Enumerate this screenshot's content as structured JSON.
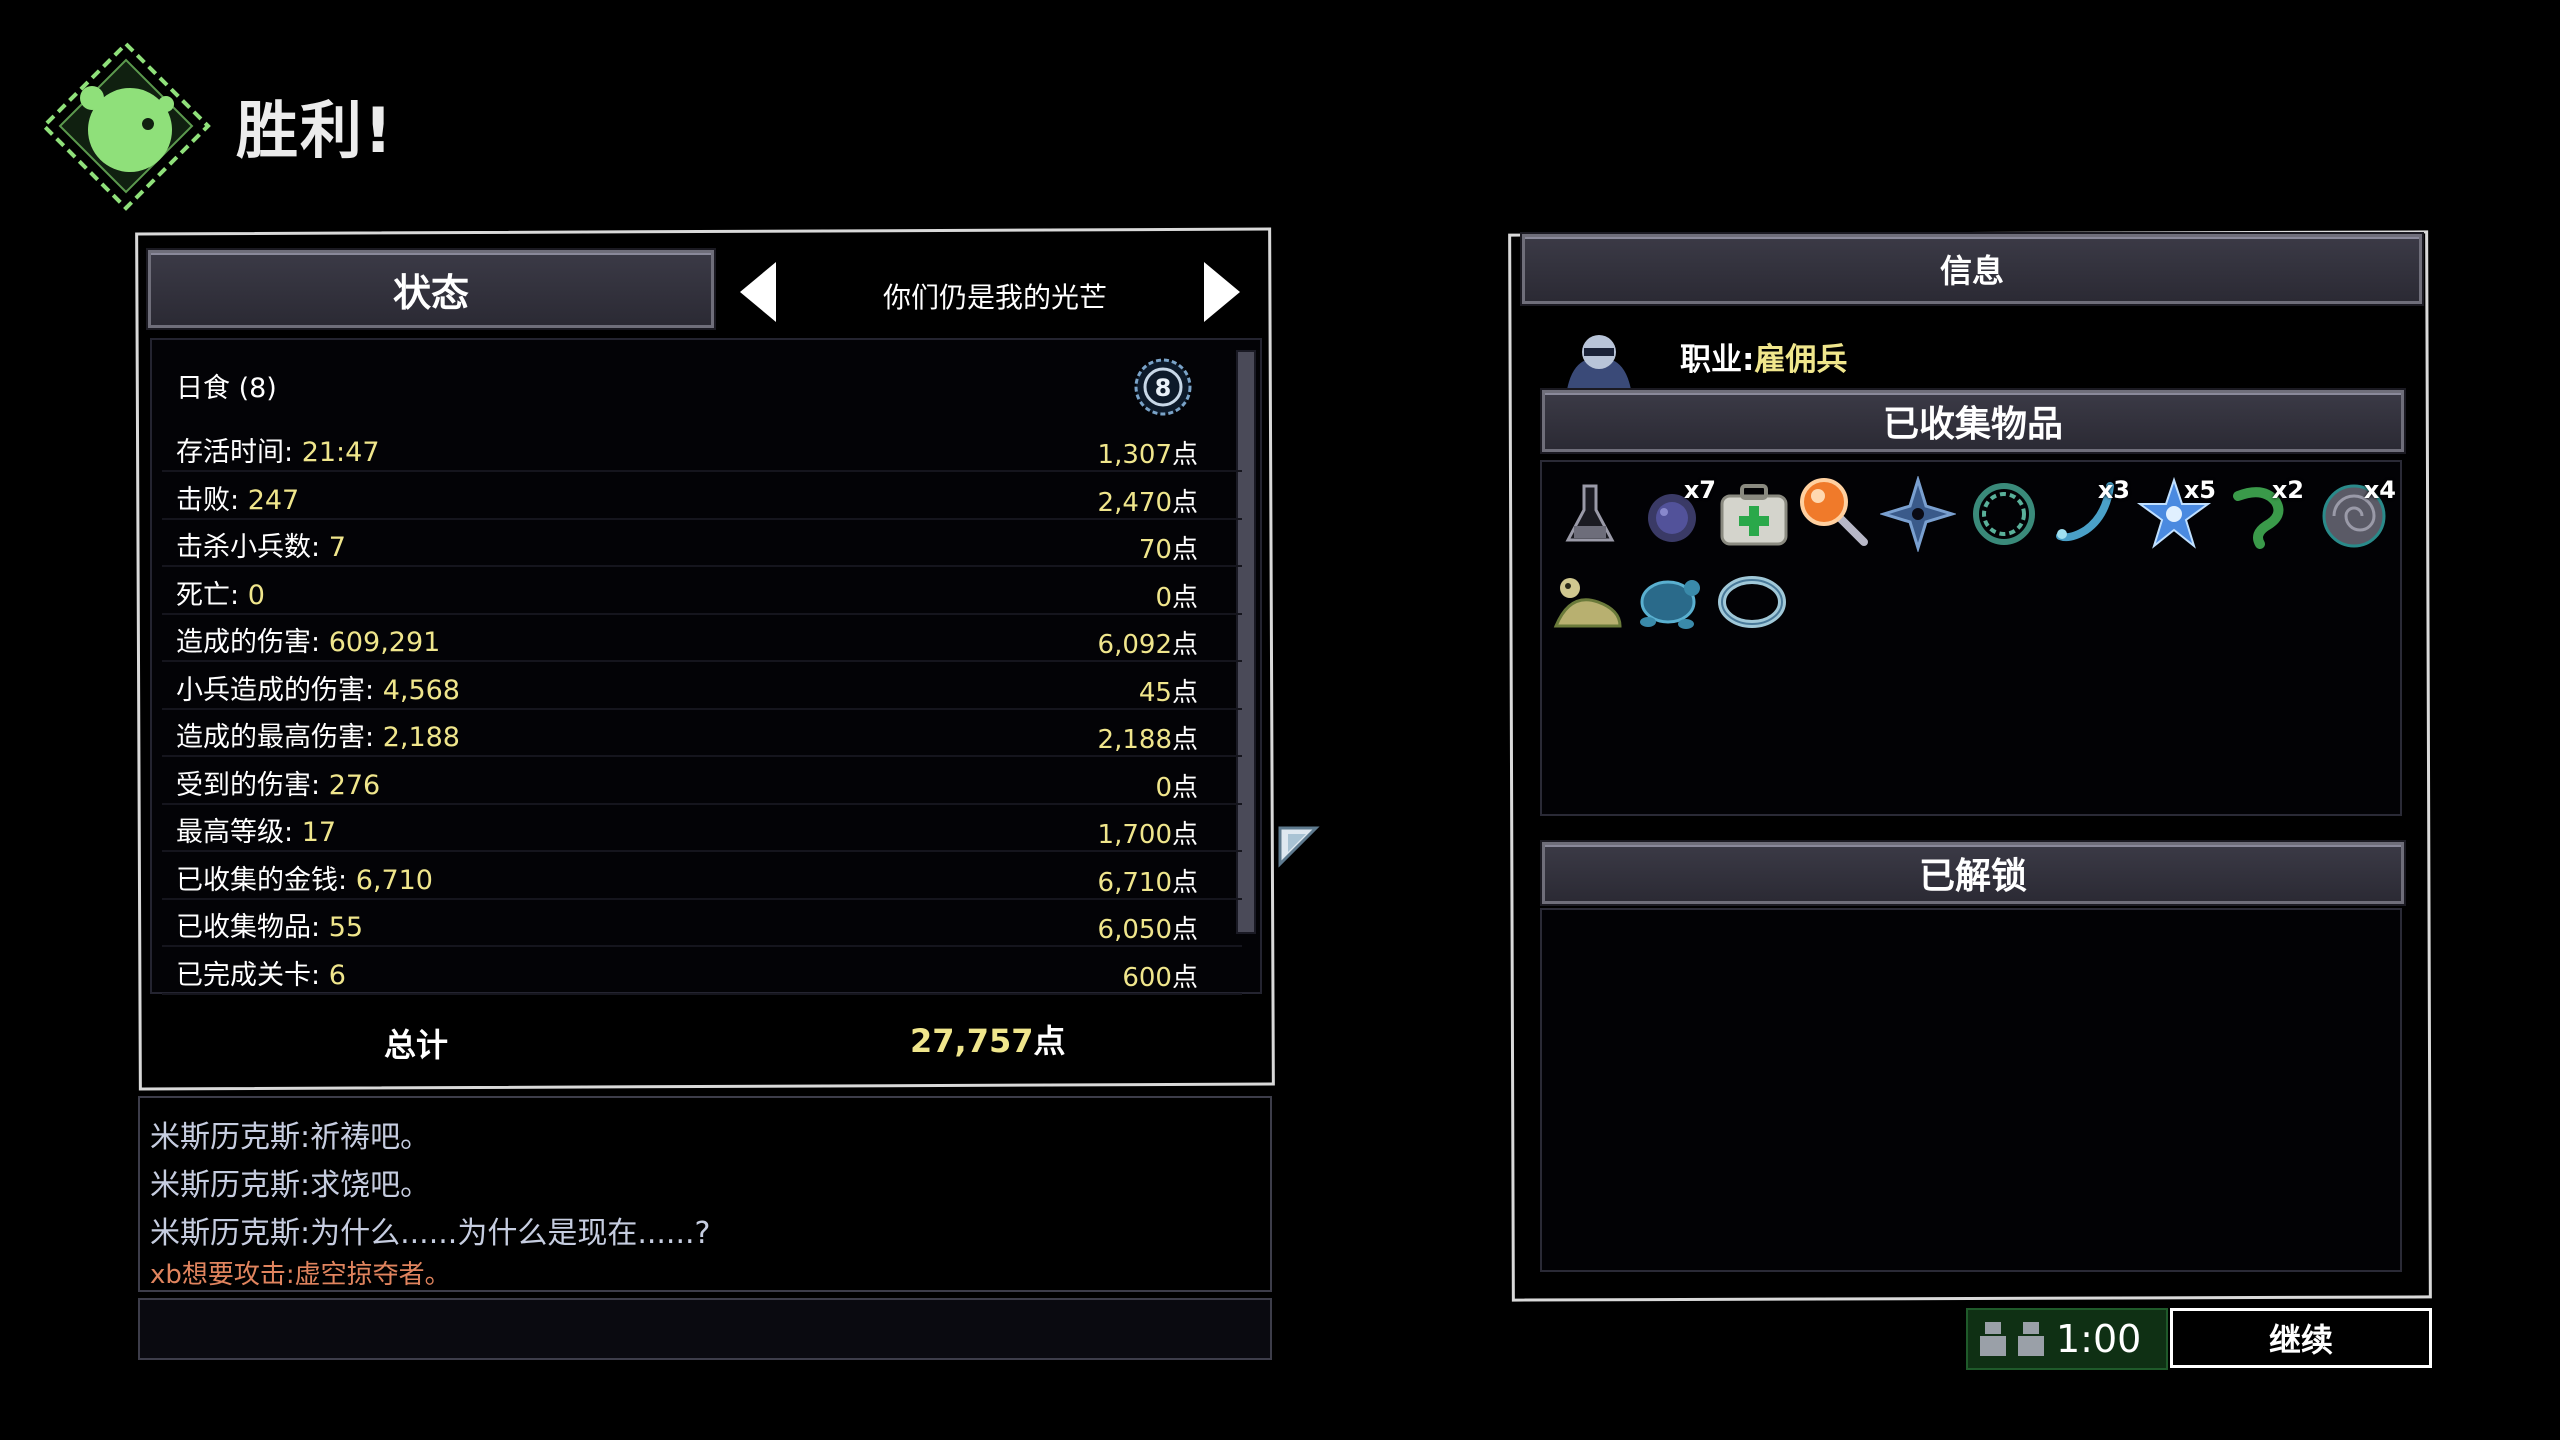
{
  "header": {
    "title": "胜利!"
  },
  "stats": {
    "tab_label": "状态",
    "subtitle": "你们仍是我的光芒",
    "difficulty": "日食 (8)",
    "rows": [
      {
        "label": "存活时间: ",
        "value": "21:47",
        "points": "1,307",
        "unit": "点"
      },
      {
        "label": "击败: ",
        "value": "247",
        "points": "2,470",
        "unit": "点"
      },
      {
        "label": "击杀小兵数: ",
        "value": "7",
        "points": "70",
        "unit": "点"
      },
      {
        "label": "死亡: ",
        "value": "0",
        "points": "0",
        "unit": "点"
      },
      {
        "label": "造成的伤害: ",
        "value": "609,291",
        "points": "6,092",
        "unit": "点"
      },
      {
        "label": "小兵造成的伤害: ",
        "value": "4,568",
        "points": "45",
        "unit": "点"
      },
      {
        "label": "造成的最高伤害: ",
        "value": "2,188",
        "points": "2,188",
        "unit": "点"
      },
      {
        "label": "受到的伤害: ",
        "value": "276",
        "points": "0",
        "unit": "点"
      },
      {
        "label": "最高等级: ",
        "value": "17",
        "points": "1,700",
        "unit": "点"
      },
      {
        "label": "已收集的金钱: ",
        "value": "6,710",
        "points": "6,710",
        "unit": "点"
      },
      {
        "label": "已收集物品: ",
        "value": "55",
        "points": "6,050",
        "unit": "点"
      },
      {
        "label": "已完成关卡: ",
        "value": "6",
        "points": "600",
        "unit": "点"
      }
    ],
    "total_label": "总计",
    "total_value": "27,757",
    "total_unit": "点"
  },
  "chat": {
    "lines": [
      "米斯历克斯:祈祷吧。",
      "米斯历克斯:求饶吧。",
      "米斯历克斯:为什么......为什么是现在......?"
    ],
    "system_line": "xb想要攻击:虚空掠夺者。"
  },
  "info": {
    "tab_label": "信息",
    "class_label": "职业:",
    "class_value": "雇佣兵",
    "items_title": "已收集物品",
    "items": [
      {
        "icon": "flask-icon",
        "count": ""
      },
      {
        "icon": "urchin-icon",
        "count": "x7"
      },
      {
        "icon": "medkit-icon",
        "count": ""
      },
      {
        "icon": "magnifier-icon",
        "count": ""
      },
      {
        "icon": "shuriken-icon",
        "count": ""
      },
      {
        "icon": "coil-icon",
        "count": ""
      },
      {
        "icon": "hook-icon",
        "count": "x3"
      },
      {
        "icon": "star-icon",
        "count": "x5"
      },
      {
        "icon": "tentacle-icon",
        "count": "x2"
      },
      {
        "icon": "shell-icon",
        "count": "x4"
      },
      {
        "icon": "slug-icon",
        "count": ""
      },
      {
        "icon": "turtle-icon",
        "count": ""
      },
      {
        "icon": "ring-icon",
        "count": ""
      }
    ],
    "unlocked_title": "已解锁"
  },
  "footer": {
    "timer": "1:00",
    "continue_label": "继续"
  },
  "colors": {
    "highlight": "#f0e68c",
    "chat": "#c6cde0",
    "system": "#e0845e",
    "logo": "#8fe07a"
  }
}
